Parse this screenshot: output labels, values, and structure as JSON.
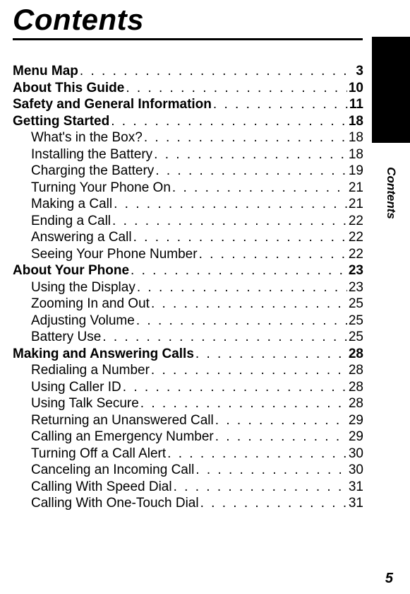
{
  "title": "Contents",
  "side_label": "Contents",
  "footer_page": "5",
  "toc": [
    {
      "label": "Menu Map",
      "page": "3",
      "bold": true,
      "sub": false
    },
    {
      "label": "About This Guide",
      "page": "10",
      "bold": true,
      "sub": false
    },
    {
      "label": "Safety and General Information",
      "page": "11",
      "bold": true,
      "sub": false
    },
    {
      "label": "Getting Started",
      "page": "18",
      "bold": true,
      "sub": false
    },
    {
      "label": "What's in the Box?",
      "page": "18",
      "bold": false,
      "sub": true
    },
    {
      "label": "Installing the Battery",
      "page": "18",
      "bold": false,
      "sub": true
    },
    {
      "label": "Charging the Battery",
      "page": "19",
      "bold": false,
      "sub": true
    },
    {
      "label": "Turning Your Phone On",
      "page": "21",
      "bold": false,
      "sub": true
    },
    {
      "label": "Making a Call",
      "page": "21",
      "bold": false,
      "sub": true
    },
    {
      "label": "Ending a Call",
      "page": "22",
      "bold": false,
      "sub": true
    },
    {
      "label": "Answering a Call",
      "page": "22",
      "bold": false,
      "sub": true
    },
    {
      "label": "Seeing Your Phone Number",
      "page": "22",
      "bold": false,
      "sub": true
    },
    {
      "label": "About Your Phone",
      "page": "23",
      "bold": true,
      "sub": false
    },
    {
      "label": "Using the Display",
      "page": "23",
      "bold": false,
      "sub": true
    },
    {
      "label": "Zooming In and Out",
      "page": "25",
      "bold": false,
      "sub": true
    },
    {
      "label": "Adjusting Volume",
      "page": "25",
      "bold": false,
      "sub": true
    },
    {
      "label": "Battery Use",
      "page": "25",
      "bold": false,
      "sub": true
    },
    {
      "label": "Making and Answering Calls",
      "page": "28",
      "bold": true,
      "sub": false
    },
    {
      "label": "Redialing a Number",
      "page": "28",
      "bold": false,
      "sub": true
    },
    {
      "label": "Using Caller ID",
      "page": "28",
      "bold": false,
      "sub": true
    },
    {
      "label": "Using Talk Secure",
      "page": "28",
      "bold": false,
      "sub": true
    },
    {
      "label": "Returning an Unanswered Call",
      "page": "29",
      "bold": false,
      "sub": true
    },
    {
      "label": "Calling an Emergency Number",
      "page": "29",
      "bold": false,
      "sub": true
    },
    {
      "label": "Turning Off a Call Alert",
      "page": "30",
      "bold": false,
      "sub": true
    },
    {
      "label": "Canceling an Incoming Call",
      "page": "30",
      "bold": false,
      "sub": true
    },
    {
      "label": "Calling With Speed Dial",
      "page": "31",
      "bold": false,
      "sub": true
    },
    {
      "label": "Calling With One-Touch Dial",
      "page": "31",
      "bold": false,
      "sub": true
    }
  ]
}
